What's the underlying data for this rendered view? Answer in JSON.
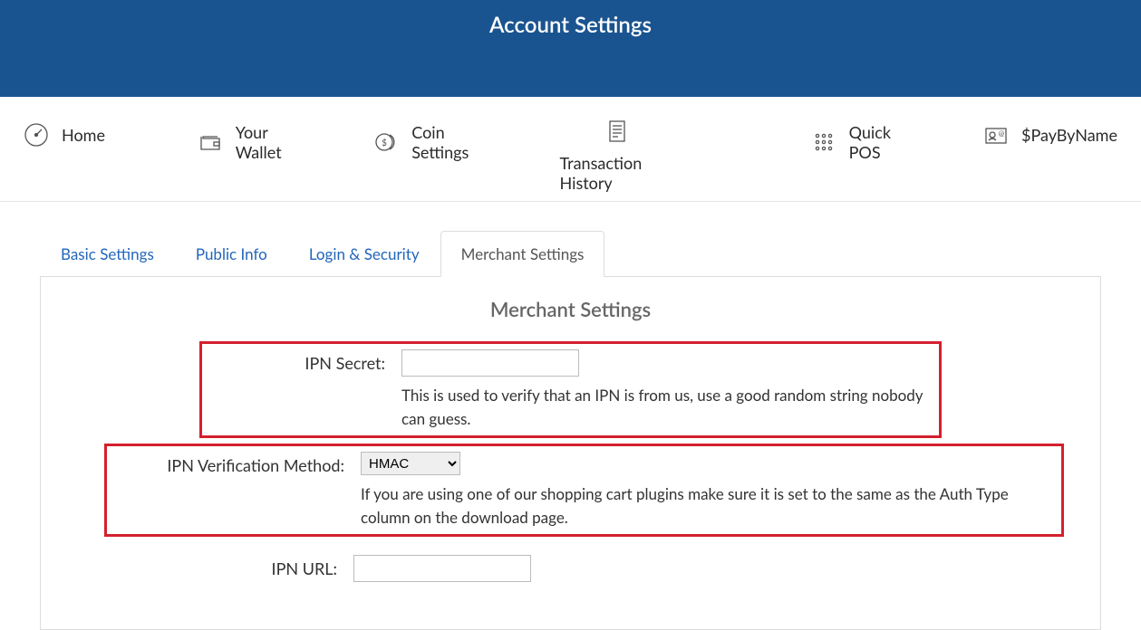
{
  "header": {
    "title": "Account Settings"
  },
  "nav": {
    "home": "Home",
    "wallet": "Your Wallet",
    "coin": "Coin Settings",
    "history": "Transaction History",
    "pos": "Quick POS",
    "paybyname": "$PayByName"
  },
  "tabs": {
    "basic": "Basic Settings",
    "public": "Public Info",
    "login": "Login & Security",
    "merchant": "Merchant Settings"
  },
  "panel": {
    "title": "Merchant Settings",
    "ipn_secret": {
      "label": "IPN Secret:",
      "value": "",
      "help": "This is used to verify that an IPN is from us, use a good random string nobody can guess."
    },
    "ipn_method": {
      "label": "IPN Verification Method:",
      "value": "HMAC",
      "help": "If you are using one of our shopping cart plugins make sure it is set to the same as the Auth Type column on the download page."
    },
    "ipn_url": {
      "label": "IPN URL:",
      "value": ""
    }
  }
}
